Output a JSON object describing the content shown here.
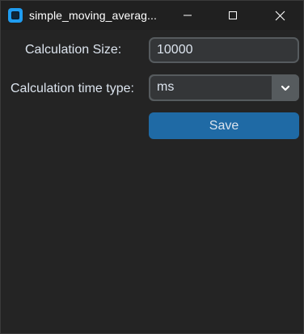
{
  "window": {
    "title": "simple_moving_averag...",
    "icon": "app-icon"
  },
  "controls": {
    "minimize_icon": "minimize-icon",
    "maximize_icon": "maximize-icon",
    "close_icon": "close-icon"
  },
  "form": {
    "calculation_size_label": "Calculation Size:",
    "calculation_size_value": "10000",
    "calculation_time_type_label": "Calculation time type:",
    "calculation_time_type_value": "ms",
    "save_label": "Save"
  },
  "colors": {
    "background": "#242424",
    "accent": "#1f6aa5",
    "entry_bg": "#343638",
    "border": "#565b5e",
    "text": "#dce4ee"
  }
}
